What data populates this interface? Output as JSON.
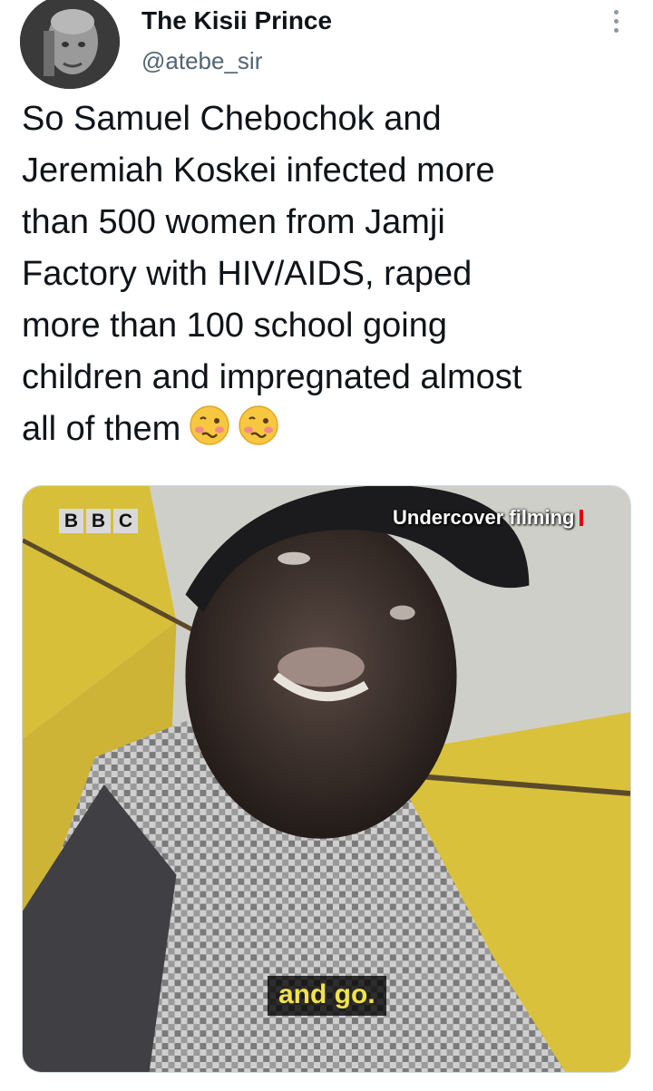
{
  "author": {
    "display_name": "The Kisii Prince",
    "handle": "@atebe_sir",
    "avatar_icon": "profile-avatar"
  },
  "more_icon": "more-vertical-icon",
  "tweet": {
    "text": "So Samuel Chebochok and\nJeremiah Koskei infected more\nthan 500 women from Jamji\nFactory with HIV/AIDS, raped\nmore than 100 school going\nchildren and impregnated almost\nall of them",
    "emojis": [
      "woozy-face",
      "woozy-face"
    ]
  },
  "media": {
    "logo_text": [
      "B",
      "B",
      "C"
    ],
    "overlay_label": "Undercover filming",
    "caption": "and go."
  },
  "colors": {
    "handle": "#536471",
    "caption_text": "#f2e34a",
    "wall_yellow": "#d9c13c"
  }
}
